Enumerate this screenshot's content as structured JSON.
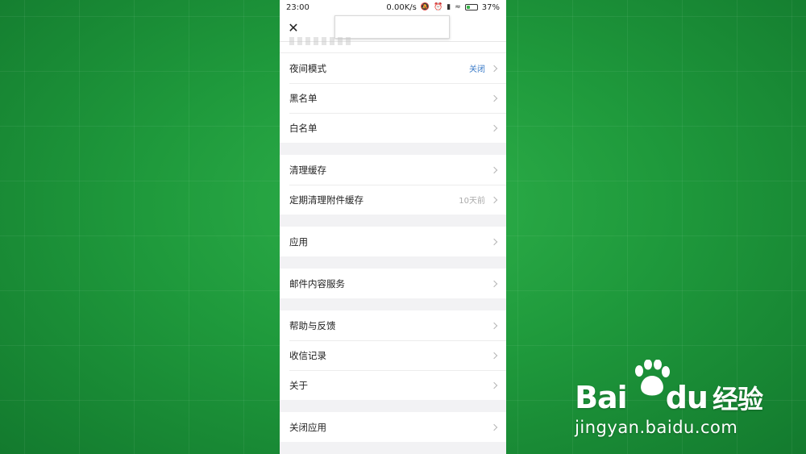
{
  "status_bar": {
    "time": "23:00",
    "net_speed": "0.00K/s",
    "battery_percent": "37%",
    "battery_level": 0.37
  },
  "header": {
    "close_icon": "close-icon"
  },
  "settings": {
    "group1": [
      {
        "label": "夜间模式",
        "value": "关闭"
      },
      {
        "label": "黑名单",
        "value": ""
      },
      {
        "label": "白名单",
        "value": ""
      }
    ],
    "group2": [
      {
        "label": "清理缓存",
        "value": ""
      },
      {
        "label": "定期清理附件缓存",
        "value": "10天前"
      }
    ],
    "group3": [
      {
        "label": "应用",
        "value": ""
      }
    ],
    "group4": [
      {
        "label": "邮件内容服务",
        "value": ""
      }
    ],
    "group5": [
      {
        "label": "帮助与反馈",
        "value": ""
      },
      {
        "label": "收信记录",
        "value": ""
      },
      {
        "label": "关于",
        "value": ""
      }
    ],
    "group6": [
      {
        "label": "关闭应用",
        "value": ""
      }
    ]
  },
  "watermark": {
    "brand_latin": "Bai",
    "brand_du": "du",
    "brand_cn": "经验",
    "url": "jingyan.baidu.com"
  },
  "colors": {
    "background_green": "#1f9a3c",
    "accent_blue": "#3b7bc8",
    "battery_green": "#35b346"
  }
}
